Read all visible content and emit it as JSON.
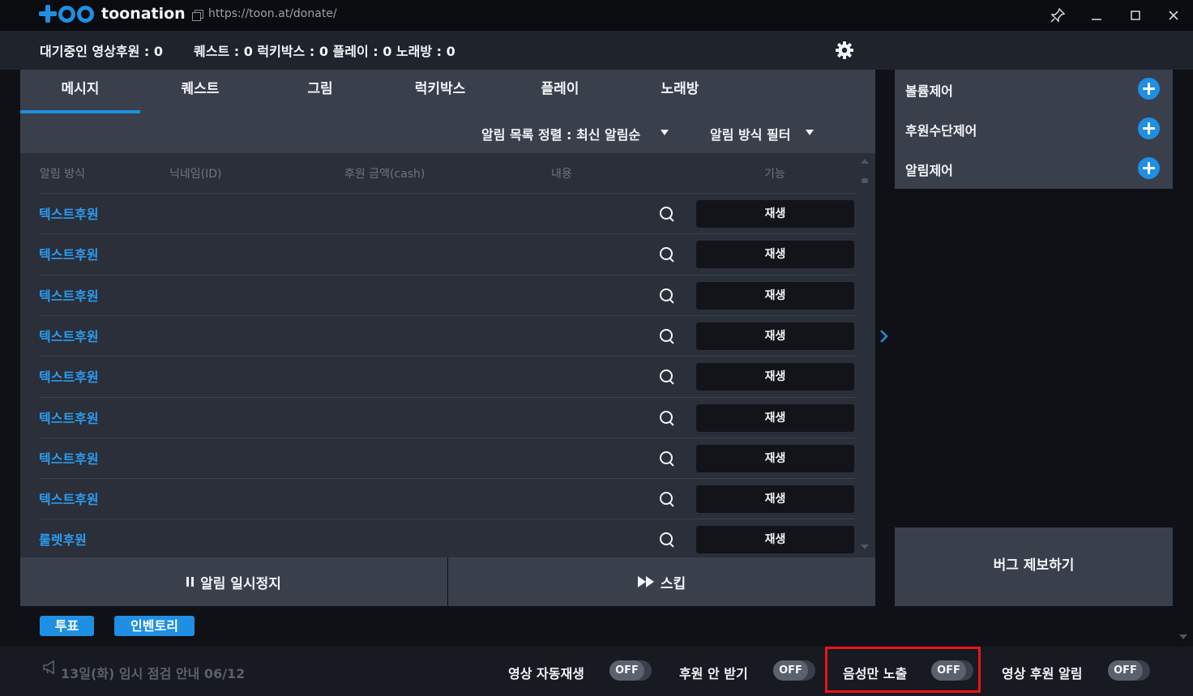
{
  "titlebar": {
    "logo_text": "toonation",
    "url": "https://toon.at/donate/",
    "pin_icon": "pin-icon",
    "minimize_icon": "minimize-icon",
    "maximize_icon": "maximize-icon",
    "close_icon": "close-icon"
  },
  "stats": {
    "waiting_video": "대기중인 영상후원 : 0",
    "others": "퀘스트 : 0 럭키박스 : 0 플레이 : 0 노래방 : 0",
    "settings_icon": "gear-icon"
  },
  "tabs": [
    {
      "label": "메시지",
      "active": true
    },
    {
      "label": "퀘스트",
      "active": false
    },
    {
      "label": "그림",
      "active": false
    },
    {
      "label": "럭키박스",
      "active": false
    },
    {
      "label": "플레이",
      "active": false
    },
    {
      "label": "노래방",
      "active": false
    }
  ],
  "filters": {
    "sort_label": "알림 목록 정렬 : 최신 알림순",
    "method_filter_label": "알림 방식 필터"
  },
  "table": {
    "columns": [
      "알림 방식",
      "닉네임(ID)",
      "후원 금액(cash)",
      "내용",
      "기능"
    ],
    "play_label": "재생",
    "rows": [
      {
        "method": "텍스트후원"
      },
      {
        "method": "텍스트후원"
      },
      {
        "method": "텍스트후원"
      },
      {
        "method": "텍스트후원"
      },
      {
        "method": "텍스트후원"
      },
      {
        "method": "텍스트후원"
      },
      {
        "method": "텍스트후원"
      },
      {
        "method": "텍스트후원"
      },
      {
        "method": "룰렛후원"
      }
    ]
  },
  "actions": {
    "pause_label": "알림 일시정지",
    "skip_label": "스킵"
  },
  "right_panel": {
    "controls": [
      "볼륨제어",
      "후원수단제어",
      "알림제어"
    ],
    "bug_report_label": "버그 제보하기"
  },
  "pills": [
    "투표",
    "인벤토리"
  ],
  "footer": {
    "notice": "13일(화) 임시 점검 안내 06/12",
    "toggles": [
      {
        "label": "영상 자동재생",
        "state": "OFF"
      },
      {
        "label": "후원 안 받기",
        "state": "OFF"
      },
      {
        "label": "음성만 노출",
        "state": "OFF"
      },
      {
        "label": "영상 후원 알림",
        "state": "OFF"
      }
    ]
  },
  "colors": {
    "accent": "#1e8fe3",
    "link": "#2b9bf0",
    "highlight": "#e8141c"
  }
}
